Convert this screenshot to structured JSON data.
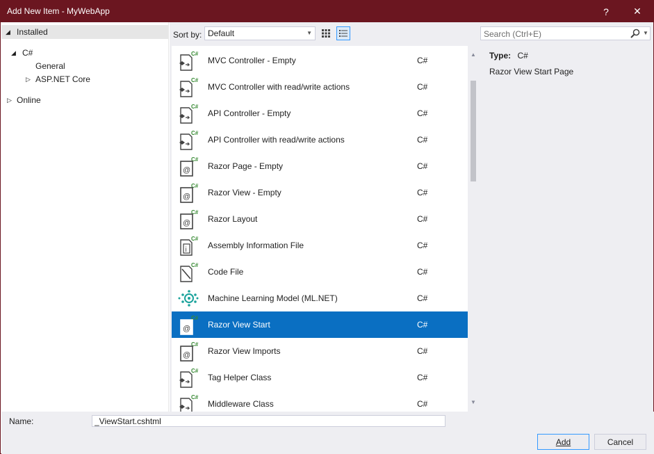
{
  "window": {
    "title": "Add New Item - MyWebApp",
    "help_glyph": "?",
    "close_glyph": "✕",
    "accent": "#6b1620"
  },
  "tree": {
    "installed": "Installed",
    "csharp": "C#",
    "general": "General",
    "aspnet": "ASP.NET Core",
    "online": "Online"
  },
  "sort": {
    "label": "Sort by:",
    "value": "Default"
  },
  "templates": [
    {
      "name": "MVC Controller - Empty",
      "lang": "C#",
      "icon": "controller-icon"
    },
    {
      "name": "MVC Controller with read/write actions",
      "lang": "C#",
      "icon": "controller-icon"
    },
    {
      "name": "API Controller - Empty",
      "lang": "C#",
      "icon": "controller-icon"
    },
    {
      "name": "API Controller with read/write actions",
      "lang": "C#",
      "icon": "controller-icon"
    },
    {
      "name": "Razor Page - Empty",
      "lang": "C#",
      "icon": "razor-icon"
    },
    {
      "name": "Razor View - Empty",
      "lang": "C#",
      "icon": "razor-icon"
    },
    {
      "name": "Razor Layout",
      "lang": "C#",
      "icon": "razor-icon"
    },
    {
      "name": "Assembly Information File",
      "lang": "C#",
      "icon": "info-file-icon"
    },
    {
      "name": "Code File",
      "lang": "C#",
      "icon": "code-file-icon"
    },
    {
      "name": "Machine Learning Model (ML.NET)",
      "lang": "C#",
      "icon": "ml-model-icon"
    },
    {
      "name": "Razor View Start",
      "lang": "C#",
      "icon": "razor-icon",
      "selected": true
    },
    {
      "name": "Razor View Imports",
      "lang": "C#",
      "icon": "razor-icon"
    },
    {
      "name": "Tag Helper Class",
      "lang": "C#",
      "icon": "controller-icon"
    },
    {
      "name": "Middleware Class",
      "lang": "C#",
      "icon": "controller-icon"
    }
  ],
  "search": {
    "placeholder": "Search (Ctrl+E)"
  },
  "details": {
    "type_label": "Type:",
    "type_value": "C#",
    "description": "Razor View Start Page"
  },
  "bottom": {
    "name_label": "Name:",
    "name_value": "_ViewStart.cshtml",
    "add_label": "Add",
    "cancel_label": "Cancel"
  },
  "colors": {
    "selection": "#0a6fc2",
    "ml_icon": "#1ba39c"
  }
}
